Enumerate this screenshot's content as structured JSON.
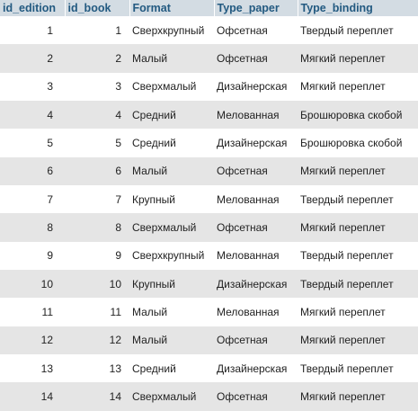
{
  "columns": [
    "id_edition",
    "id_book",
    "Format",
    "Type_paper",
    "Type_binding"
  ],
  "rows": [
    [
      "1",
      "1",
      "Сверхкрупный",
      "Офсетная",
      "Твердый переплет"
    ],
    [
      "2",
      "2",
      "Малый",
      "Офсетная",
      "Мягкий переплет"
    ],
    [
      "3",
      "3",
      "Сверхмалый",
      "Дизайнерская",
      "Мягкий переплет"
    ],
    [
      "4",
      "4",
      "Средний",
      "Мелованная",
      "Брошюровка скобой"
    ],
    [
      "5",
      "5",
      "Средний",
      "Дизайнерская",
      "Брошюровка скобой"
    ],
    [
      "6",
      "6",
      "Малый",
      "Офсетная",
      "Мягкий переплет"
    ],
    [
      "7",
      "7",
      "Крупный",
      "Мелованная",
      "Твердый переплет"
    ],
    [
      "8",
      "8",
      "Сверхмалый",
      "Офсетная",
      "Мягкий переплет"
    ],
    [
      "9",
      "9",
      "Сверхкрупный",
      "Мелованная",
      "Твердый переплет"
    ],
    [
      "10",
      "10",
      "Крупный",
      "Дизайнерская",
      "Твердый переплет"
    ],
    [
      "11",
      "11",
      "Малый",
      "Мелованная",
      "Мягкий переплет"
    ],
    [
      "12",
      "12",
      "Малый",
      "Офсетная",
      "Мягкий переплет"
    ],
    [
      "13",
      "13",
      "Средний",
      "Дизайнерская",
      "Твердый переплет"
    ],
    [
      "14",
      "14",
      "Сверхмалый",
      "Офсетная",
      "Мягкий переплет"
    ]
  ],
  "colors": {
    "header_bg": "#d3dce3",
    "header_text": "#235a81",
    "row_even_bg": "#ffffff",
    "row_odd_bg": "#e5e5e5",
    "text": "#222222"
  }
}
